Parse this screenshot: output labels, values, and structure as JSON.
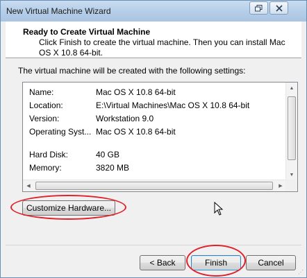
{
  "window": {
    "title": "New Virtual Machine Wizard",
    "restore_icon": "restore-icon",
    "close_icon": "close-icon"
  },
  "header": {
    "title": "Ready to Create Virtual Machine",
    "description": "Click Finish to create the virtual machine. Then you can install Mac OS X 10.8 64-bit."
  },
  "content": {
    "settings_label": "The virtual machine will be created with the following settings:",
    "settings": [
      {
        "key": "Name:",
        "value": "Mac OS X 10.8 64-bit"
      },
      {
        "key": "Location:",
        "value": "E:\\Virtual Machines\\Mac OS X 10.8 64-bit"
      },
      {
        "key": "Version:",
        "value": "Workstation 9.0"
      },
      {
        "key": "Operating Syst...",
        "value": "Mac OS X 10.8 64-bit"
      },
      {
        "key": "Hard Disk:",
        "value": "40 GB"
      },
      {
        "key": "Memory:",
        "value": "3820 MB"
      }
    ],
    "customize_label": "Customize Hardware..."
  },
  "footer": {
    "back_label": "< Back",
    "finish_label": "Finish",
    "cancel_label": "Cancel"
  },
  "colors": {
    "annotation": "#e0202a",
    "titlebar": "#b4cde8"
  }
}
